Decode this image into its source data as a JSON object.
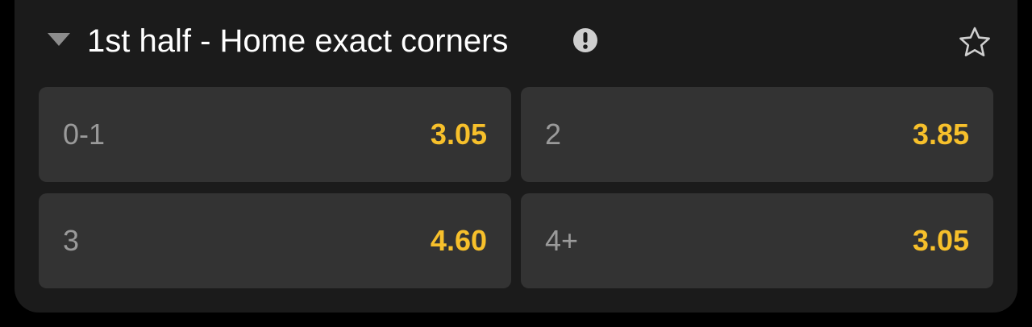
{
  "market": {
    "title": "1st half - Home exact corners",
    "collapse_icon": "triangle-down-icon",
    "info_icon": "exclamation-circle-icon",
    "favorite_icon": "star-outline-icon"
  },
  "outcomes": [
    {
      "label": "0-1",
      "odds": "3.05"
    },
    {
      "label": "2",
      "odds": "3.85"
    },
    {
      "label": "3",
      "odds": "4.60"
    },
    {
      "label": "4+",
      "odds": "3.05"
    }
  ],
  "colors": {
    "background": "#000000",
    "panel": "#1b1b1b",
    "tile": "#333333",
    "odds": "#f7c02b",
    "label": "#9a9a9a",
    "title": "#ffffff"
  }
}
